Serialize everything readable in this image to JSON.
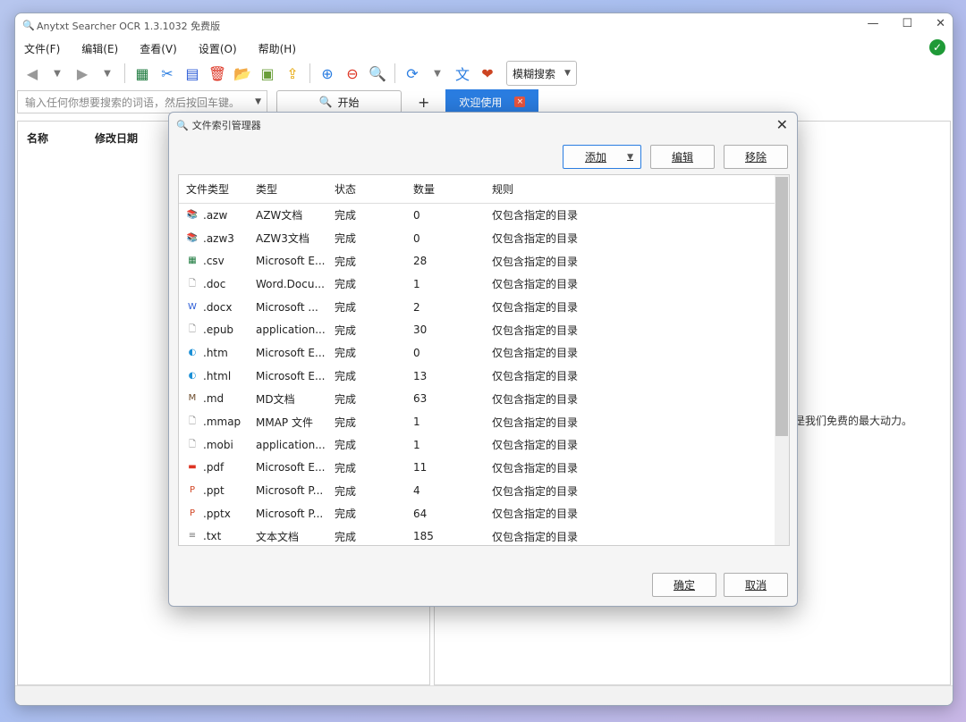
{
  "window": {
    "title": "Anytxt Searcher OCR 1.3.1032 免费版",
    "controls": [
      "—",
      "☐",
      "✕"
    ]
  },
  "menu": [
    "文件(F)",
    "编辑(E)",
    "查看(V)",
    "设置(O)",
    "帮助(H)"
  ],
  "toolbar": {
    "fuzzy_label": "模糊搜索"
  },
  "search": {
    "placeholder": "输入任何你想要搜索的词语，然后按回车键。",
    "start_label": "开始",
    "plus": "+"
  },
  "tab": {
    "label": "欢迎使用"
  },
  "left_panel": {
    "col_name": "名称",
    "col_modified": "修改日期"
  },
  "right_panel": {
    "text": "是我们免费的最大动力。"
  },
  "dialog": {
    "title": "文件索引管理器",
    "add_label": "添加",
    "edit_label": "编辑",
    "remove_label": "移除",
    "ok_label": "确定",
    "cancel_label": "取消",
    "columns": [
      "文件类型",
      "类型",
      "状态",
      "数量",
      "规则"
    ],
    "rows": [
      {
        "ext": ".azw",
        "type": "AZW文档",
        "status": "完成",
        "count": "0",
        "rule": "仅包含指定的目录",
        "icon": "book-icon"
      },
      {
        "ext": ".azw3",
        "type": "AZW3文档",
        "status": "完成",
        "count": "0",
        "rule": "仅包含指定的目录",
        "icon": "book-icon"
      },
      {
        "ext": ".csv",
        "type": "Microsoft E...",
        "status": "完成",
        "count": "28",
        "rule": "仅包含指定的目录",
        "icon": "excel-icon"
      },
      {
        "ext": ".doc",
        "type": "Word.Docu...",
        "status": "完成",
        "count": "1",
        "rule": "仅包含指定的目录",
        "icon": "blank-file-icon"
      },
      {
        "ext": ".docx",
        "type": "Microsoft ...",
        "status": "完成",
        "count": "2",
        "rule": "仅包含指定的目录",
        "icon": "word-icon"
      },
      {
        "ext": ".epub",
        "type": "application...",
        "status": "完成",
        "count": "30",
        "rule": "仅包含指定的目录",
        "icon": "blank-file-icon"
      },
      {
        "ext": ".htm",
        "type": "Microsoft E...",
        "status": "完成",
        "count": "0",
        "rule": "仅包含指定的目录",
        "icon": "edge-icon"
      },
      {
        "ext": ".html",
        "type": "Microsoft E...",
        "status": "完成",
        "count": "13",
        "rule": "仅包含指定的目录",
        "icon": "edge-icon"
      },
      {
        "ext": ".md",
        "type": "MD文档",
        "status": "完成",
        "count": "63",
        "rule": "仅包含指定的目录",
        "icon": "markdown-icon"
      },
      {
        "ext": ".mmap",
        "type": "MMAP 文件",
        "status": "完成",
        "count": "1",
        "rule": "仅包含指定的目录",
        "icon": "blank-file-icon"
      },
      {
        "ext": ".mobi",
        "type": "application...",
        "status": "完成",
        "count": "1",
        "rule": "仅包含指定的目录",
        "icon": "blank-file-icon"
      },
      {
        "ext": ".pdf",
        "type": "Microsoft E...",
        "status": "完成",
        "count": "11",
        "rule": "仅包含指定的目录",
        "icon": "pdf-icon"
      },
      {
        "ext": ".ppt",
        "type": "Microsoft P...",
        "status": "完成",
        "count": "4",
        "rule": "仅包含指定的目录",
        "icon": "ppt-icon"
      },
      {
        "ext": ".pptx",
        "type": "Microsoft P...",
        "status": "完成",
        "count": "64",
        "rule": "仅包含指定的目录",
        "icon": "ppt-icon"
      },
      {
        "ext": ".txt",
        "type": "文本文档",
        "status": "完成",
        "count": "185",
        "rule": "仅包含指定的目录",
        "icon": "text-file-icon"
      }
    ]
  }
}
